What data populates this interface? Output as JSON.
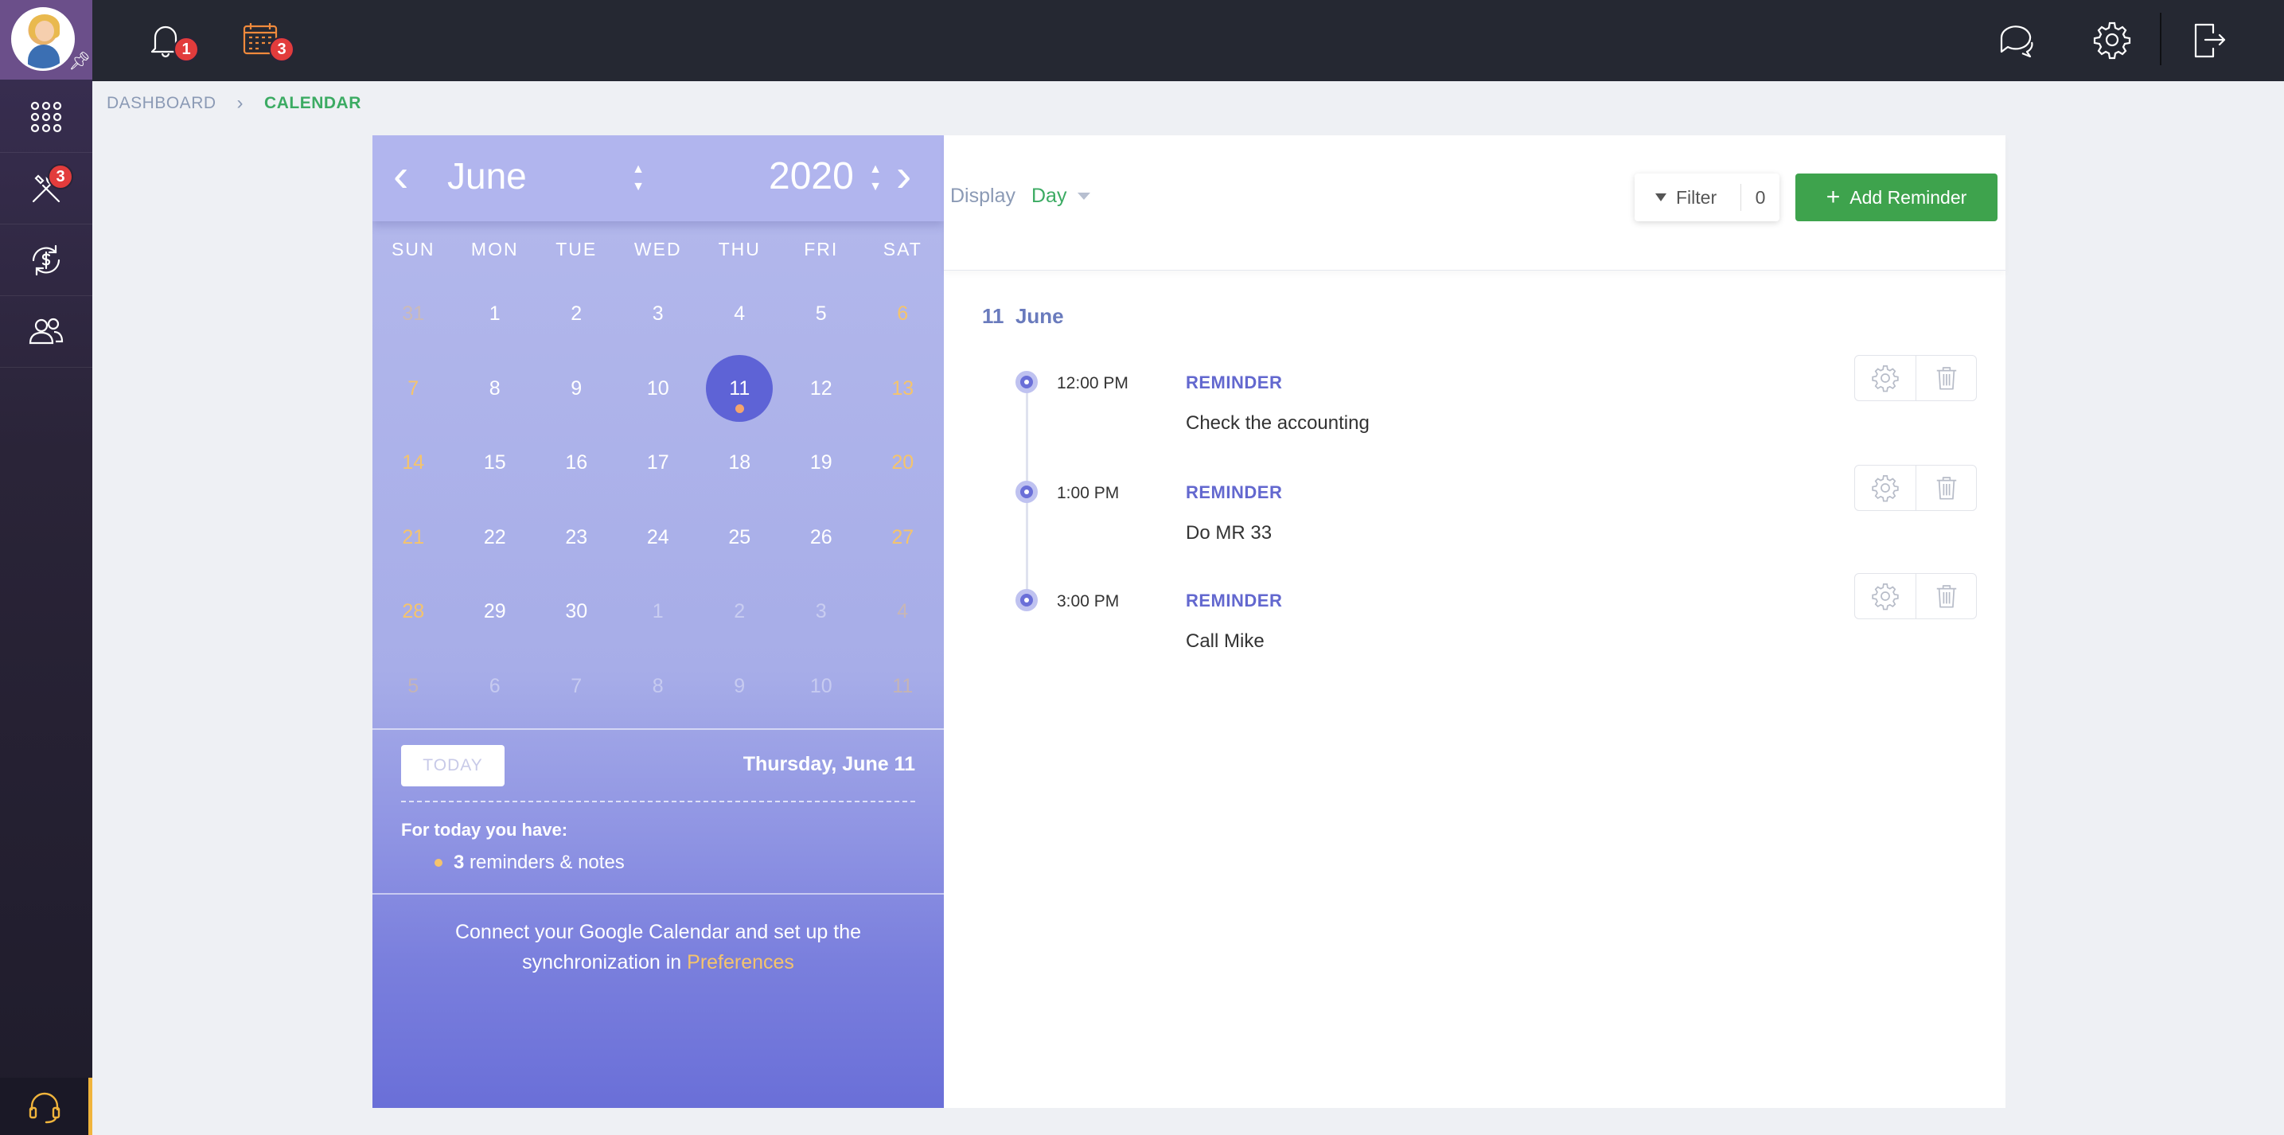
{
  "sidebar": {
    "tools_badge": "3",
    "items": [
      {
        "name": "apps",
        "icon": "grid-icon"
      },
      {
        "name": "tools",
        "icon": "wrench-screwdriver-icon"
      },
      {
        "name": "finance",
        "icon": "dollar-sync-icon"
      },
      {
        "name": "users",
        "icon": "users-icon"
      }
    ],
    "support_icon": "headset-icon"
  },
  "topbar": {
    "notifications_badge": "1",
    "calendar_badge": "3",
    "icons": [
      "bell-icon",
      "calendar-icon",
      "chat-icon",
      "gear-icon",
      "logout-icon"
    ]
  },
  "breadcrumb": {
    "home": "DASHBOARD",
    "separator": "›",
    "current": "CALENDAR"
  },
  "calendar": {
    "month": "June",
    "year": "2020",
    "prev": "‹",
    "next": "›",
    "weekdays": [
      "SUN",
      "MON",
      "TUE",
      "WED",
      "THU",
      "FRI",
      "SAT"
    ],
    "weeks": [
      [
        "31",
        "1",
        "2",
        "3",
        "4",
        "5",
        "6"
      ],
      [
        "7",
        "8",
        "9",
        "10",
        "11",
        "12",
        "13"
      ],
      [
        "14",
        "15",
        "16",
        "17",
        "18",
        "19",
        "20"
      ],
      [
        "21",
        "22",
        "23",
        "24",
        "25",
        "26",
        "27"
      ],
      [
        "28",
        "29",
        "30",
        "1",
        "2",
        "3",
        "4"
      ],
      [
        "5",
        "6",
        "7",
        "8",
        "9",
        "10",
        "11"
      ]
    ],
    "today_button": "TODAY",
    "today_date": "Thursday, June 11",
    "for_today_label": "For today you have:",
    "reminder_count": "3",
    "reminder_suffix": "reminders & notes",
    "connect_text_1": "Connect your Google Calendar and set up the",
    "connect_text_2": "synchronization in",
    "connect_link": "Preferences"
  },
  "main": {
    "display_label": "Display",
    "display_value": "Day",
    "filter_label": "Filter",
    "filter_count": "0",
    "add_button": "Add Reminder",
    "date_day": "11",
    "date_month": "June",
    "events": [
      {
        "time": "12:00 PM",
        "type": "REMINDER",
        "text": "Check the accounting"
      },
      {
        "time": "1:00 PM",
        "type": "REMINDER",
        "text": "Do MR 33"
      },
      {
        "time": "3:00 PM",
        "type": "REMINDER",
        "text": "Call Mike"
      }
    ]
  },
  "colors": {
    "accent_green": "#3ea34d",
    "calendar_purple": "#6a6fd8",
    "weekend_yellow": "#f5c46c",
    "badge_red": "#e23c3c"
  }
}
